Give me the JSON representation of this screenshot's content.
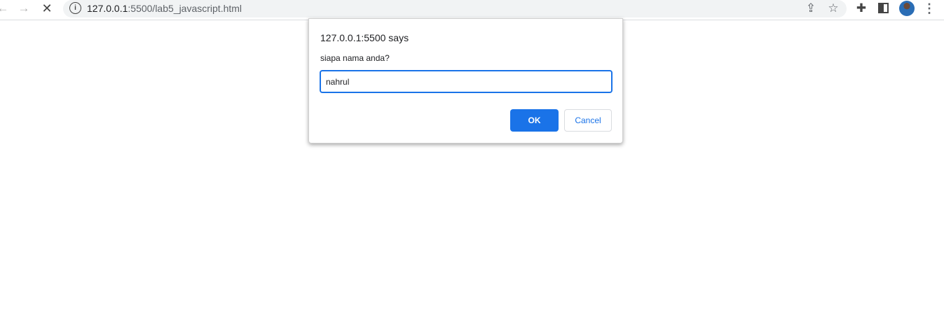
{
  "browser": {
    "url_host": "127.0.0.1",
    "url_path": ":5500/lab5_javascript.html",
    "icons": [
      "back-icon",
      "forward-icon",
      "stop-icon",
      "info-icon",
      "share-icon",
      "star-icon",
      "extensions-icon",
      "side-panel-icon",
      "avatar",
      "menu-icon"
    ]
  },
  "dialog": {
    "title": "127.0.0.1:5500 says",
    "message": "siapa nama anda?",
    "input_value": "nahrul",
    "ok_label": "OK",
    "cancel_label": "Cancel"
  },
  "colors": {
    "accent": "#1a73e8"
  }
}
